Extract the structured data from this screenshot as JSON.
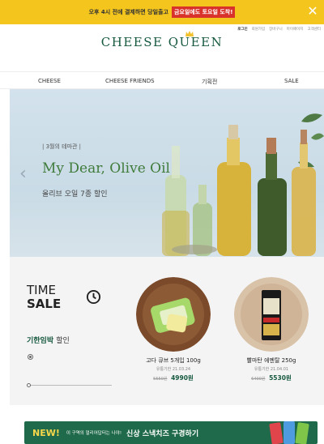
{
  "promo": {
    "text": "오후 4시 전에 결제하면 당일출고",
    "highlight": "금요일에도 토요일 도착!",
    "close_icon": "close-icon"
  },
  "util_links": [
    "로그인",
    "회원가입",
    "장바구니",
    "마이페이지",
    "고객센터"
  ],
  "logo": {
    "text": "CHEESE QUEEN",
    "crown_icon": "crown-icon"
  },
  "nav": [
    "CHEESE",
    "CHEESE FRIENDS",
    "기획전",
    "SALE"
  ],
  "hero": {
    "tag": "| 3월의 테마관 |",
    "title": "My Dear, Olive Oil",
    "subtitle": "올리브 오일 7종 할인",
    "prev_icon": "chevron-left-icon"
  },
  "time_sale": {
    "title_line1": "TIME",
    "title_line2": "SALE",
    "clock_icon": "clock-icon",
    "imminent": "기한임박",
    "imminent_suffix": "할인",
    "products": [
      {
        "name": "고다 큐브 5개입 100g",
        "expiry": "유통기한 21.03.24",
        "old_price": "5550원",
        "price": "4990원"
      },
      {
        "name": "빨마탄 에멘탈 250g",
        "expiry": "유통기한 21.04.01",
        "old_price": "6400원",
        "price": "5530원"
      }
    ]
  },
  "banner": {
    "new": "NEW!",
    "desc": "이 구역의 멀리어답터는 나야!",
    "cta": "신상 스낵치즈 구경하기"
  },
  "colors": {
    "brand": "#16593f",
    "promo_bg": "#f4c51c",
    "promo_highlight": "#d9322a",
    "banner_bg": "#1f6a4a"
  }
}
